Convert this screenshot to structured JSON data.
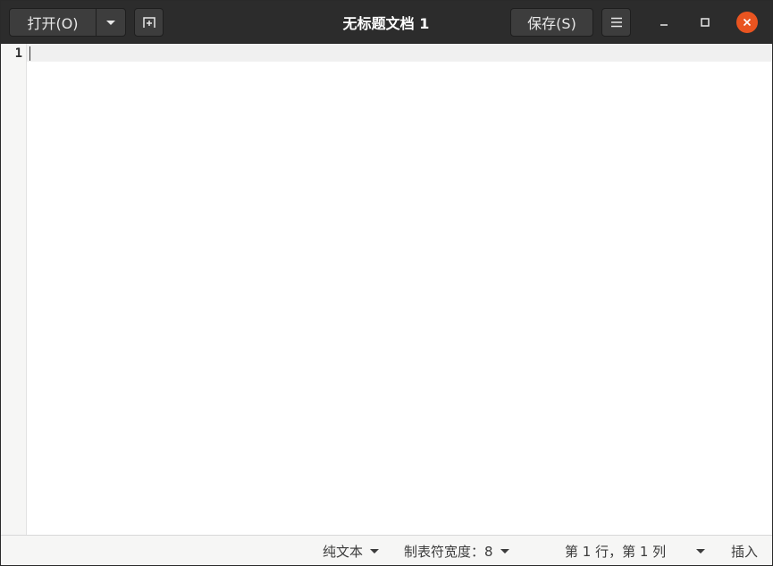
{
  "window": {
    "title": "无标题文档 1"
  },
  "headerbar": {
    "open_label": "打开(O)",
    "save_label": "保存(S)",
    "icons": {
      "open_menu": "chevron-down-icon",
      "new_tab": "new-tab-icon",
      "menu": "hamburger-menu-icon",
      "minimize": "minimize-icon",
      "maximize": "maximize-icon",
      "close": "close-icon"
    }
  },
  "editor": {
    "line_numbers": [
      "1"
    ],
    "content": ""
  },
  "statusbar": {
    "language": "纯文本",
    "tab_width": "制表符宽度：8",
    "position": "第 1 行，第 1 列",
    "mode": "插入"
  },
  "colors": {
    "headerbar_bg": "#2c2c2c",
    "close_button": "#e95420",
    "gutter_bg": "#f6f6f5",
    "statusbar_bg": "#f6f6f5"
  }
}
